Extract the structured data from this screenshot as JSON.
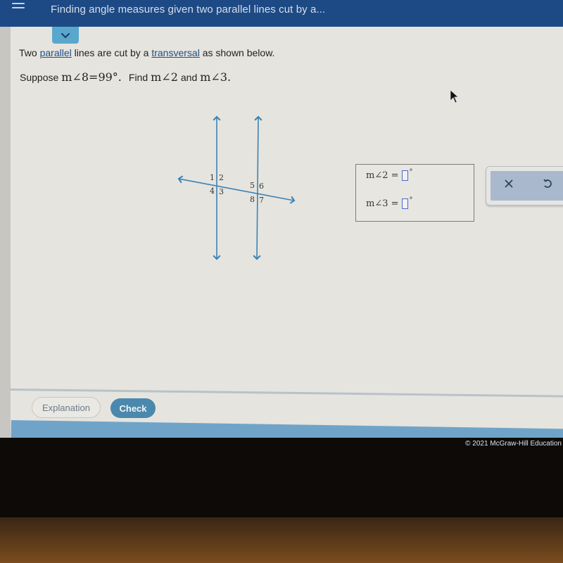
{
  "header": {
    "title": "Finding angle measures given two parallel lines cut by a...",
    "menu_icon": "hamburger-menu-icon",
    "collapse_icon": "chevron-down-icon"
  },
  "problem": {
    "line1_pre": "Two ",
    "line1_link1": "parallel",
    "line1_mid": " lines are cut by a ",
    "line1_link2": "transversal",
    "line1_post": " as shown below.",
    "suppose_label": "Suppose",
    "given": "m∠8=99°.",
    "find_label": "Find",
    "find_angle_a": "m∠2",
    "and_label": "and",
    "find_angle_b": "m∠3."
  },
  "diagram": {
    "angle_labels_left": [
      "1",
      "2",
      "4",
      "3"
    ],
    "angle_labels_right": [
      "5",
      "6",
      "8",
      "7"
    ],
    "line_color": "#3b83b5"
  },
  "answers": {
    "row1_label": "m∠2 =",
    "row1_value": "",
    "row2_label": "m∠3 =",
    "row2_value": "",
    "unit": "°"
  },
  "tools": {
    "clear_icon": "close-icon",
    "undo_icon": "undo-icon"
  },
  "buttons": {
    "explanation": "Explanation",
    "check": "Check"
  },
  "footer": {
    "copyright": "© 2021 McGraw-Hill Education"
  },
  "colors": {
    "header_bg": "#1d4a85",
    "accent": "#4b88ad",
    "link": "#1e4f87"
  }
}
